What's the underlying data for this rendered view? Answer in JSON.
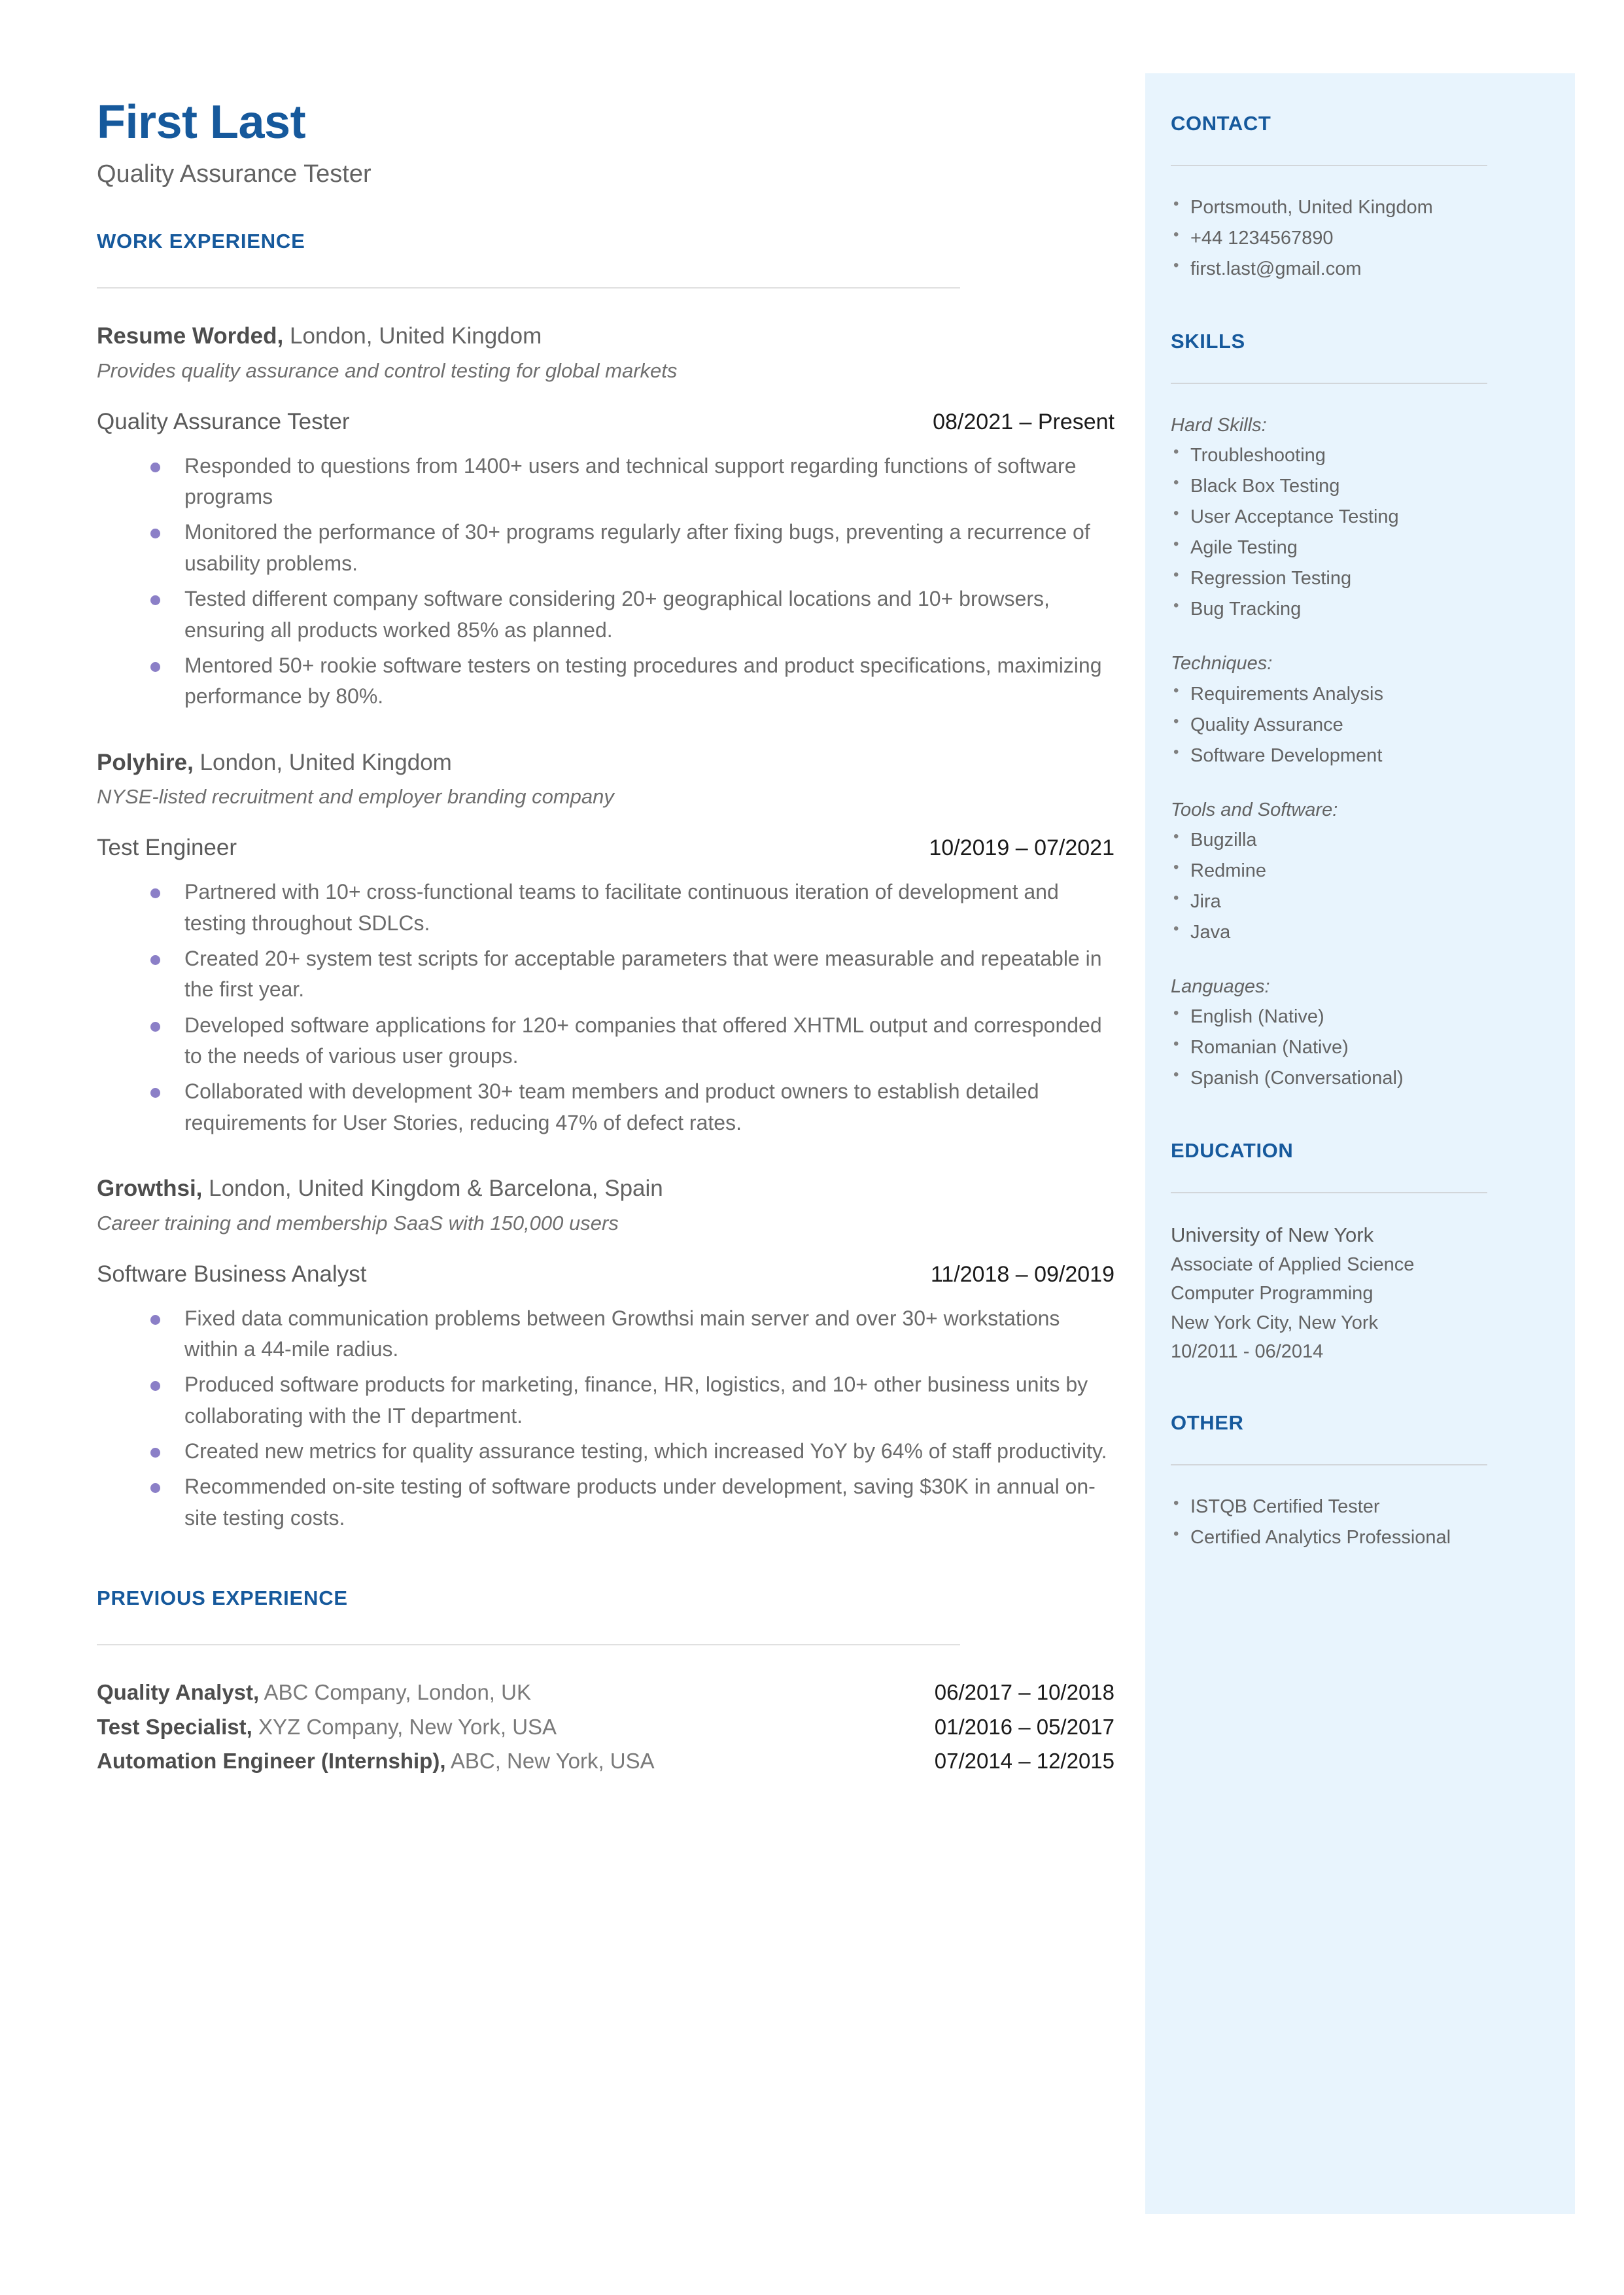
{
  "colors": {
    "accent_blue": "#16599c",
    "sidebar_bg": "#e8f4fd",
    "bullet_purple": "#8b7fc7",
    "body_gray": "#6b6b6b"
  },
  "header": {
    "name": "First Last",
    "title": "Quality Assurance Tester"
  },
  "sections": {
    "work_experience_heading": "WORK EXPERIENCE",
    "previous_experience_heading": "PREVIOUS EXPERIENCE"
  },
  "jobs": [
    {
      "company": "Resume Worded,",
      "location": " London, United Kingdom",
      "description": "Provides quality assurance and control testing for global markets",
      "role": "Quality Assurance Tester",
      "dates": "08/2021 – Present",
      "bullets": [
        "Responded to questions from 1400+ users and technical support regarding functions of software programs",
        "Monitored the performance of 30+ programs regularly after fixing bugs, preventing a recurrence of usability problems.",
        "Tested different company software considering 20+ geographical locations and 10+ browsers, ensuring all products worked 85% as planned.",
        "Mentored 50+ rookie software testers on testing procedures and product specifications, maximizing performance by 80%."
      ]
    },
    {
      "company": "Polyhire,",
      "location": " London, United Kingdom",
      "description": "NYSE-listed recruitment and employer branding company",
      "role": "Test Engineer",
      "dates": "10/2019 – 07/2021",
      "bullets": [
        "Partnered with 10+ cross-functional teams to facilitate continuous iteration of development and testing throughout SDLCs.",
        "Created 20+ system test scripts for acceptable parameters that were measurable and repeatable in the first year.",
        "Developed software applications for 120+ companies that offered XHTML output and corresponded to the needs of various user groups.",
        "Collaborated with development 30+ team members and product owners to establish detailed requirements for User Stories, reducing 47% of defect rates."
      ]
    },
    {
      "company": "Growthsi,",
      "location": " London, United Kingdom & Barcelona, Spain",
      "description": "Career training and membership SaaS with 150,000 users",
      "role": "Software Business Analyst",
      "dates": "11/2018 – 09/2019",
      "bullets": [
        "Fixed data communication problems between Growthsi main server and over 30+ workstations within a 44-mile radius.",
        "Produced software products for marketing, finance, HR, logistics, and 10+ other business units by collaborating with the IT department.",
        "Created new metrics for quality assurance testing, which increased YoY by 64% of staff productivity.",
        "Recommended on-site testing of software products under development, saving $30K in annual on-site testing costs."
      ]
    }
  ],
  "previous_experience": [
    {
      "role": "Quality Analyst,",
      "detail": " ABC Company, London, UK",
      "dates": "06/2017 – 10/2018"
    },
    {
      "role": "Test Specialist,",
      "detail": " XYZ Company, New York, USA",
      "dates": "01/2016 – 05/2017"
    },
    {
      "role": "Automation Engineer (Internship),",
      "detail": " ABC, New York, USA",
      "dates": "07/2014 – 12/2015"
    }
  ],
  "sidebar": {
    "contact": {
      "heading": "CONTACT",
      "items": [
        "Portsmouth, United Kingdom",
        "+44 1234567890",
        "first.last@gmail.com"
      ]
    },
    "skills": {
      "heading": "SKILLS",
      "groups": [
        {
          "label": "Hard Skills:",
          "items": [
            "Troubleshooting",
            "Black Box Testing",
            "User Acceptance Testing",
            "Agile Testing",
            "Regression Testing",
            "Bug Tracking"
          ]
        },
        {
          "label": "Techniques:",
          "items": [
            "Requirements Analysis",
            "Quality Assurance",
            "Software Development"
          ]
        },
        {
          "label": "Tools and Software:",
          "items": [
            "Bugzilla",
            "Redmine",
            "Jira",
            "Java"
          ]
        },
        {
          "label": "Languages:",
          "items": [
            "English (Native)",
            "Romanian (Native)",
            "Spanish (Conversational)"
          ]
        }
      ]
    },
    "education": {
      "heading": "EDUCATION",
      "school": "University of New York",
      "degree": "Associate of Applied Science",
      "field": "Computer Programming",
      "location": "New York City, New York",
      "dates": "10/2011 - 06/2014"
    },
    "other": {
      "heading": "OTHER",
      "items": [
        "ISTQB Certified Tester",
        "Certified Analytics Professional"
      ]
    }
  }
}
